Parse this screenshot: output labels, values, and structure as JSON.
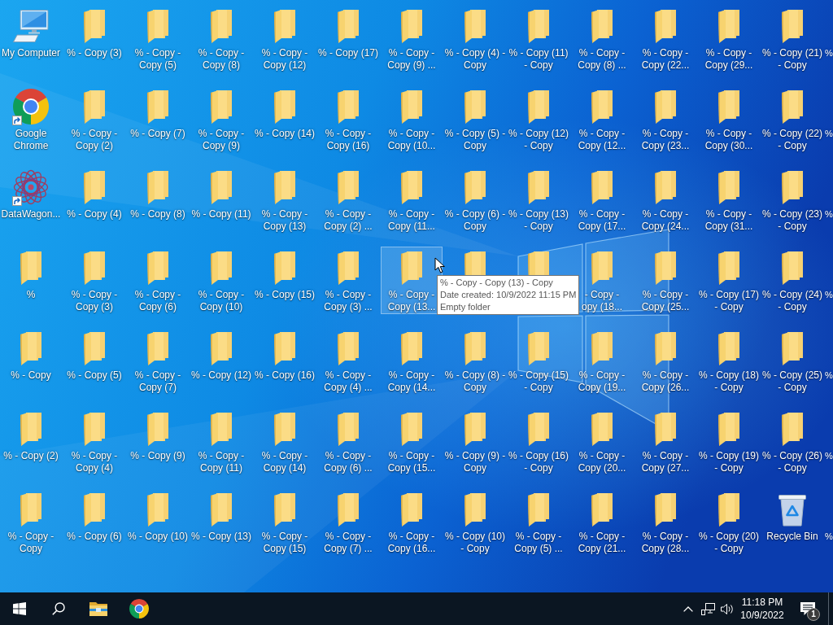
{
  "desktop": {
    "rows": [
      {
        "icons": [
          {
            "kind": "computer",
            "label": "My Computer",
            "selected": false,
            "shortcut": false
          },
          {
            "kind": "folder",
            "label": "% - Copy (3)",
            "selected": false,
            "shortcut": false
          },
          {
            "kind": "folder",
            "label": "% - Copy -\nCopy (5)",
            "selected": false,
            "shortcut": false
          },
          {
            "kind": "folder",
            "label": "% - Copy -\nCopy (8)",
            "selected": false,
            "shortcut": false
          },
          {
            "kind": "folder",
            "label": "% - Copy -\nCopy (12)",
            "selected": false,
            "shortcut": false
          },
          {
            "kind": "folder",
            "label": "% - Copy (17)",
            "selected": false,
            "shortcut": false
          },
          {
            "kind": "folder",
            "label": "% - Copy -\nCopy (9) ...",
            "selected": false,
            "shortcut": false
          },
          {
            "kind": "folder",
            "label": "% - Copy (4) -\nCopy",
            "selected": false,
            "shortcut": false
          },
          {
            "kind": "folder",
            "label": "% - Copy (11)\n- Copy",
            "selected": false,
            "shortcut": false
          },
          {
            "kind": "folder",
            "label": "% - Copy -\nCopy (8) ...",
            "selected": false,
            "shortcut": false
          },
          {
            "kind": "folder",
            "label": "% - Copy -\nCopy (22...",
            "selected": false,
            "shortcut": false
          },
          {
            "kind": "folder",
            "label": "% - Copy -\nCopy (29...",
            "selected": false,
            "shortcut": false
          },
          {
            "kind": "folder",
            "label": "% - Copy (21)\n- Copy",
            "selected": false,
            "shortcut": false
          }
        ],
        "edge_label": "%"
      },
      {
        "icons": [
          {
            "kind": "chrome",
            "label": "Google\nChrome",
            "selected": false,
            "shortcut": true
          },
          {
            "kind": "folder",
            "label": "% - Copy -\nCopy (2)",
            "selected": false,
            "shortcut": false
          },
          {
            "kind": "folder",
            "label": "% - Copy (7)",
            "selected": false,
            "shortcut": false
          },
          {
            "kind": "folder",
            "label": "% - Copy -\nCopy (9)",
            "selected": false,
            "shortcut": false
          },
          {
            "kind": "folder",
            "label": "% - Copy (14)",
            "selected": false,
            "shortcut": false
          },
          {
            "kind": "folder",
            "label": "% - Copy -\nCopy (16)",
            "selected": false,
            "shortcut": false
          },
          {
            "kind": "folder",
            "label": "% - Copy -\nCopy (10...",
            "selected": false,
            "shortcut": false
          },
          {
            "kind": "folder",
            "label": "% - Copy (5) -\nCopy",
            "selected": false,
            "shortcut": false
          },
          {
            "kind": "folder",
            "label": "% - Copy (12)\n- Copy",
            "selected": false,
            "shortcut": false
          },
          {
            "kind": "folder",
            "label": "% - Copy -\nCopy (12...",
            "selected": false,
            "shortcut": false
          },
          {
            "kind": "folder",
            "label": "% - Copy -\nCopy (23...",
            "selected": false,
            "shortcut": false
          },
          {
            "kind": "folder",
            "label": "% - Copy -\nCopy (30...",
            "selected": false,
            "shortcut": false
          },
          {
            "kind": "folder",
            "label": "% - Copy (22)\n- Copy",
            "selected": false,
            "shortcut": false
          }
        ],
        "edge_label": "%"
      },
      {
        "icons": [
          {
            "kind": "app",
            "label": "DataWagon...",
            "selected": false,
            "shortcut": true
          },
          {
            "kind": "folder",
            "label": "% - Copy (4)",
            "selected": false,
            "shortcut": false
          },
          {
            "kind": "folder",
            "label": "% - Copy (8)",
            "selected": false,
            "shortcut": false
          },
          {
            "kind": "folder",
            "label": "% - Copy (11)",
            "selected": false,
            "shortcut": false
          },
          {
            "kind": "folder",
            "label": "% - Copy -\nCopy (13)",
            "selected": false,
            "shortcut": false
          },
          {
            "kind": "folder",
            "label": "% - Copy -\nCopy (2) ...",
            "selected": false,
            "shortcut": false
          },
          {
            "kind": "folder",
            "label": "% - Copy -\nCopy (11...",
            "selected": false,
            "shortcut": false
          },
          {
            "kind": "folder",
            "label": "% - Copy (6) -\nCopy",
            "selected": false,
            "shortcut": false
          },
          {
            "kind": "folder",
            "label": "% - Copy (13)\n- Copy",
            "selected": false,
            "shortcut": false
          },
          {
            "kind": "folder",
            "label": "% - Copy -\nCopy (17...",
            "selected": false,
            "shortcut": false
          },
          {
            "kind": "folder",
            "label": "% - Copy -\nCopy (24...",
            "selected": false,
            "shortcut": false
          },
          {
            "kind": "folder",
            "label": "% - Copy -\nCopy (31...",
            "selected": false,
            "shortcut": false
          },
          {
            "kind": "folder",
            "label": "% - Copy (23)\n- Copy",
            "selected": false,
            "shortcut": false
          }
        ],
        "edge_label": "%"
      },
      {
        "icons": [
          {
            "kind": "folder",
            "label": "%",
            "selected": false,
            "shortcut": false
          },
          {
            "kind": "folder",
            "label": "% - Copy -\nCopy (3)",
            "selected": false,
            "shortcut": false
          },
          {
            "kind": "folder",
            "label": "% - Copy -\nCopy (6)",
            "selected": false,
            "shortcut": false
          },
          {
            "kind": "folder",
            "label": "% - Copy -\nCopy (10)",
            "selected": false,
            "shortcut": false
          },
          {
            "kind": "folder",
            "label": "% - Copy (15)",
            "selected": false,
            "shortcut": false
          },
          {
            "kind": "folder",
            "label": "% - Copy -\nCopy (3) ...",
            "selected": false,
            "shortcut": false
          },
          {
            "kind": "folder",
            "label": "% - Copy -\nCopy (13...",
            "selected": true,
            "shortcut": false
          },
          {
            "kind": "folder",
            "selected": false
          },
          {
            "kind": "folder",
            "selected": false
          },
          {
            "kind": "folder",
            "label": "- Copy -\nopy (18...",
            "selected": false,
            "shortcut": false
          },
          {
            "kind": "folder",
            "label": "% - Copy -\nCopy (25...",
            "selected": false,
            "shortcut": false
          },
          {
            "kind": "folder",
            "label": "% - Copy (17)\n- Copy",
            "selected": false,
            "shortcut": false
          },
          {
            "kind": "folder",
            "label": "% - Copy (24)\n- Copy",
            "selected": false,
            "shortcut": false
          }
        ],
        "edge_label": "%"
      },
      {
        "icons": [
          {
            "kind": "folder",
            "label": "% - Copy",
            "selected": false,
            "shortcut": false
          },
          {
            "kind": "folder",
            "label": "% - Copy (5)",
            "selected": false,
            "shortcut": false
          },
          {
            "kind": "folder",
            "label": "% - Copy -\nCopy (7)",
            "selected": false,
            "shortcut": false
          },
          {
            "kind": "folder",
            "label": "% - Copy (12)",
            "selected": false,
            "shortcut": false
          },
          {
            "kind": "folder",
            "label": "% - Copy (16)",
            "selected": false,
            "shortcut": false
          },
          {
            "kind": "folder",
            "label": "% - Copy -\nCopy (4) ...",
            "selected": false,
            "shortcut": false
          },
          {
            "kind": "folder",
            "label": "% - Copy -\nCopy (14...",
            "selected": false,
            "shortcut": false
          },
          {
            "kind": "folder",
            "label": "% - Copy (8) -\nCopy",
            "selected": false,
            "shortcut": false
          },
          {
            "kind": "folder",
            "label": "% - Copy (15)\n- Copy",
            "selected": false,
            "shortcut": false
          },
          {
            "kind": "folder",
            "label": "% - Copy -\nCopy (19...",
            "selected": false,
            "shortcut": false
          },
          {
            "kind": "folder",
            "label": "% - Copy -\nCopy (26...",
            "selected": false,
            "shortcut": false
          },
          {
            "kind": "folder",
            "label": "% - Copy (18)\n- Copy",
            "selected": false,
            "shortcut": false
          },
          {
            "kind": "folder",
            "label": "% - Copy (25)\n- Copy",
            "selected": false,
            "shortcut": false
          }
        ],
        "edge_label": "%"
      },
      {
        "icons": [
          {
            "kind": "folder",
            "label": "% - Copy (2)",
            "selected": false,
            "shortcut": false
          },
          {
            "kind": "folder",
            "label": "% - Copy -\nCopy (4)",
            "selected": false,
            "shortcut": false
          },
          {
            "kind": "folder",
            "label": "% - Copy (9)",
            "selected": false,
            "shortcut": false
          },
          {
            "kind": "folder",
            "label": "% - Copy -\nCopy (11)",
            "selected": false,
            "shortcut": false
          },
          {
            "kind": "folder",
            "label": "% - Copy -\nCopy (14)",
            "selected": false,
            "shortcut": false
          },
          {
            "kind": "folder",
            "label": "% - Copy -\nCopy (6) ...",
            "selected": false,
            "shortcut": false
          },
          {
            "kind": "folder",
            "label": "% - Copy -\nCopy (15...",
            "selected": false,
            "shortcut": false
          },
          {
            "kind": "folder",
            "label": "% - Copy (9) -\nCopy",
            "selected": false,
            "shortcut": false
          },
          {
            "kind": "folder",
            "label": "% - Copy (16)\n- Copy",
            "selected": false,
            "shortcut": false
          },
          {
            "kind": "folder",
            "label": "% - Copy -\nCopy (20...",
            "selected": false,
            "shortcut": false
          },
          {
            "kind": "folder",
            "label": "% - Copy -\nCopy (27...",
            "selected": false,
            "shortcut": false
          },
          {
            "kind": "folder",
            "label": "% - Copy (19)\n- Copy",
            "selected": false,
            "shortcut": false
          },
          {
            "kind": "folder",
            "label": "% - Copy (26)\n- Copy",
            "selected": false,
            "shortcut": false
          }
        ],
        "edge_label": "%"
      },
      {
        "icons": [
          {
            "kind": "folder",
            "label": "% - Copy -\nCopy",
            "selected": false,
            "shortcut": false
          },
          {
            "kind": "folder",
            "label": "% - Copy (6)",
            "selected": false,
            "shortcut": false
          },
          {
            "kind": "folder",
            "label": "% - Copy (10)",
            "selected": false,
            "shortcut": false
          },
          {
            "kind": "folder",
            "label": "% - Copy (13)",
            "selected": false,
            "shortcut": false
          },
          {
            "kind": "folder",
            "label": "% - Copy -\nCopy (15)",
            "selected": false,
            "shortcut": false
          },
          {
            "kind": "folder",
            "label": "% - Copy -\nCopy (7) ...",
            "selected": false,
            "shortcut": false
          },
          {
            "kind": "folder",
            "label": "% - Copy -\nCopy (16...",
            "selected": false,
            "shortcut": false
          },
          {
            "kind": "folder",
            "label": "% - Copy (10)\n- Copy",
            "selected": false,
            "shortcut": false
          },
          {
            "kind": "folder",
            "label": "% - Copy -\nCopy (5) ...",
            "selected": false,
            "shortcut": false
          },
          {
            "kind": "folder",
            "label": "% - Copy -\nCopy (21...",
            "selected": false,
            "shortcut": false
          },
          {
            "kind": "folder",
            "label": "% - Copy -\nCopy (28...",
            "selected": false,
            "shortcut": false
          },
          {
            "kind": "folder",
            "label": "% - Copy (20)\n- Copy",
            "selected": false,
            "shortcut": false
          },
          {
            "kind": "recycle_bin",
            "label": "Recycle Bin",
            "selected": false,
            "shortcut": false
          }
        ],
        "edge_label": "%"
      }
    ],
    "tooltip": {
      "lines": [
        "% - Copy - Copy (13) - Copy",
        "Date created: 10/9/2022 11:15 PM",
        "Empty folder"
      ]
    }
  },
  "taskbar": {
    "pinned": [
      {
        "kind": "start"
      },
      {
        "kind": "search"
      },
      {
        "kind": "file_explorer"
      },
      {
        "kind": "chrome"
      }
    ],
    "tray_icons": [
      {
        "kind": "chevron"
      },
      {
        "kind": "network"
      },
      {
        "kind": "volume"
      }
    ],
    "clock": {
      "time": "11:18 PM",
      "date": "10/9/2022"
    },
    "notifications": {
      "count": "1"
    }
  }
}
